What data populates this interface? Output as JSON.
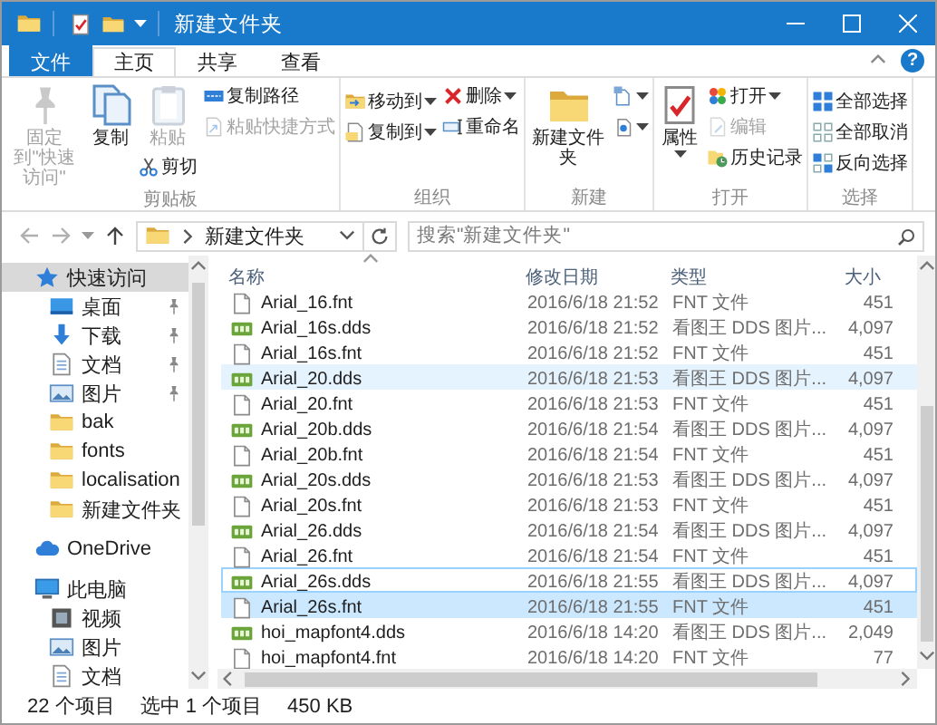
{
  "window": {
    "title": "新建文件夹"
  },
  "ribbon_tabs": [
    {
      "label": "文件",
      "kind": "file",
      "selected": false
    },
    {
      "label": "主页",
      "kind": "tab",
      "selected": true
    },
    {
      "label": "共享",
      "kind": "tab",
      "selected": false
    },
    {
      "label": "查看",
      "kind": "tab",
      "selected": false
    }
  ],
  "help_button": "?",
  "ribbon": {
    "groups": [
      {
        "label": "剪贴板",
        "columns": [
          [
            {
              "kind": "large",
              "label": "固定到\"快速访问\"",
              "disabled": true,
              "dropdown": false
            }
          ],
          [
            {
              "kind": "large",
              "label": "复制",
              "disabled": false,
              "dropdown": false
            }
          ],
          [
            {
              "kind": "large",
              "label": "粘贴",
              "disabled": true,
              "dropdown": false
            },
            {
              "kind": "small",
              "label": "剪切",
              "disabled": false,
              "dropdown": false
            }
          ],
          [
            {
              "kind": "small",
              "label": "复制路径",
              "disabled": false,
              "dropdown": false
            },
            {
              "kind": "small",
              "label": "粘贴快捷方式",
              "disabled": true,
              "dropdown": false
            }
          ]
        ]
      },
      {
        "label": "组织",
        "columns": [
          [
            {
              "kind": "small",
              "label": "移动到",
              "disabled": false,
              "dropdown": true
            },
            {
              "kind": "small",
              "label": "复制到",
              "disabled": false,
              "dropdown": true
            }
          ],
          [
            {
              "kind": "small",
              "label": "删除",
              "disabled": false,
              "dropdown": true
            },
            {
              "kind": "small",
              "label": "重命名",
              "disabled": false,
              "dropdown": false
            }
          ]
        ]
      },
      {
        "label": "新建",
        "columns": [
          [
            {
              "kind": "large",
              "label": "新建文件夹",
              "disabled": false,
              "dropdown": false
            }
          ],
          [
            {
              "kind": "icon",
              "disabled": false,
              "dropdown": true
            },
            {
              "kind": "icon",
              "disabled": false,
              "dropdown": true
            }
          ]
        ]
      },
      {
        "label": "打开",
        "columns": [
          [
            {
              "kind": "large",
              "label": "属性",
              "disabled": false,
              "dropdown": true
            }
          ],
          [
            {
              "kind": "small",
              "label": "打开",
              "disabled": false,
              "dropdown": true
            },
            {
              "kind": "small",
              "label": "编辑",
              "disabled": true,
              "dropdown": false
            },
            {
              "kind": "small",
              "label": "历史记录",
              "disabled": false,
              "dropdown": false
            }
          ]
        ]
      },
      {
        "label": "选择",
        "columns": [
          [
            {
              "kind": "small",
              "label": "全部选择",
              "disabled": false,
              "dropdown": false
            },
            {
              "kind": "small",
              "label": "全部取消",
              "disabled": false,
              "dropdown": false
            },
            {
              "kind": "small",
              "label": "反向选择",
              "disabled": false,
              "dropdown": false
            }
          ]
        ]
      }
    ]
  },
  "address": {
    "segments": [
      "新建文件夹"
    ]
  },
  "search": {
    "placeholder": "搜索\"新建文件夹\""
  },
  "nav": {
    "items": [
      {
        "label": "快速访问",
        "kind": "quick_access",
        "selected": true,
        "pinned": false,
        "children": [
          {
            "label": "桌面",
            "kind": "desktop",
            "selected": false,
            "pinned": true
          },
          {
            "label": "下载",
            "kind": "downloads",
            "selected": false,
            "pinned": true
          },
          {
            "label": "文档",
            "kind": "documents",
            "selected": false,
            "pinned": true
          },
          {
            "label": "图片",
            "kind": "pictures",
            "selected": false,
            "pinned": true
          },
          {
            "label": "bak",
            "kind": "folder",
            "selected": false,
            "pinned": false
          },
          {
            "label": "fonts",
            "kind": "folder",
            "selected": false,
            "pinned": false
          },
          {
            "label": "localisation",
            "kind": "folder",
            "selected": false,
            "pinned": false
          },
          {
            "label": "新建文件夹",
            "kind": "folder",
            "selected": false,
            "pinned": false
          }
        ]
      },
      {
        "label": "OneDrive",
        "kind": "cloud",
        "selected": false,
        "pinned": false
      },
      {
        "label": "此电脑",
        "kind": "computer",
        "selected": false,
        "pinned": false,
        "children": [
          {
            "label": "视频",
            "kind": "videos",
            "selected": false,
            "pinned": false
          },
          {
            "label": "图片",
            "kind": "pictures",
            "selected": false,
            "pinned": false
          },
          {
            "label": "文档",
            "kind": "documents",
            "selected": false,
            "pinned": false
          }
        ]
      }
    ]
  },
  "files": {
    "columns": [
      {
        "label": "名称",
        "sorted": true
      },
      {
        "label": "修改日期",
        "sorted": false
      },
      {
        "label": "类型",
        "sorted": false
      },
      {
        "label": "大小",
        "sorted": false
      }
    ],
    "rows": [
      {
        "name": "Arial_16.fnt",
        "kind": "fnt",
        "modified": "2016/6/18 21:52",
        "type": "FNT 文件",
        "size": "451",
        "selected": false,
        "hovered": false,
        "focused": false
      },
      {
        "name": "Arial_16s.dds",
        "kind": "dds",
        "modified": "2016/6/18 21:52",
        "type": "看图王 DDS 图片...",
        "size": "4,097",
        "selected": false,
        "hovered": false,
        "focused": false
      },
      {
        "name": "Arial_16s.fnt",
        "kind": "fnt",
        "modified": "2016/6/18 21:52",
        "type": "FNT 文件",
        "size": "451",
        "selected": false,
        "hovered": false,
        "focused": false
      },
      {
        "name": "Arial_20.dds",
        "kind": "dds",
        "modified": "2016/6/18 21:53",
        "type": "看图王 DDS 图片...",
        "size": "4,097",
        "selected": false,
        "hovered": true,
        "focused": false
      },
      {
        "name": "Arial_20.fnt",
        "kind": "fnt",
        "modified": "2016/6/18 21:53",
        "type": "FNT 文件",
        "size": "451",
        "selected": false,
        "hovered": false,
        "focused": false
      },
      {
        "name": "Arial_20b.dds",
        "kind": "dds",
        "modified": "2016/6/18 21:54",
        "type": "看图王 DDS 图片...",
        "size": "4,097",
        "selected": false,
        "hovered": false,
        "focused": false
      },
      {
        "name": "Arial_20b.fnt",
        "kind": "fnt",
        "modified": "2016/6/18 21:54",
        "type": "FNT 文件",
        "size": "451",
        "selected": false,
        "hovered": false,
        "focused": false
      },
      {
        "name": "Arial_20s.dds",
        "kind": "dds",
        "modified": "2016/6/18 21:53",
        "type": "看图王 DDS 图片...",
        "size": "4,097",
        "selected": false,
        "hovered": false,
        "focused": false
      },
      {
        "name": "Arial_20s.fnt",
        "kind": "fnt",
        "modified": "2016/6/18 21:53",
        "type": "FNT 文件",
        "size": "451",
        "selected": false,
        "hovered": false,
        "focused": false
      },
      {
        "name": "Arial_26.dds",
        "kind": "dds",
        "modified": "2016/6/18 21:54",
        "type": "看图王 DDS 图片...",
        "size": "4,097",
        "selected": false,
        "hovered": false,
        "focused": false
      },
      {
        "name": "Arial_26.fnt",
        "kind": "fnt",
        "modified": "2016/6/18 21:54",
        "type": "FNT 文件",
        "size": "451",
        "selected": false,
        "hovered": false,
        "focused": false
      },
      {
        "name": "Arial_26s.dds",
        "kind": "dds",
        "modified": "2016/6/18 21:55",
        "type": "看图王 DDS 图片...",
        "size": "4,097",
        "selected": false,
        "hovered": false,
        "focused": true
      },
      {
        "name": "Arial_26s.fnt",
        "kind": "fnt",
        "modified": "2016/6/18 21:55",
        "type": "FNT 文件",
        "size": "451",
        "selected": true,
        "hovered": false,
        "focused": false
      },
      {
        "name": "hoi_mapfont4.dds",
        "kind": "dds",
        "modified": "2016/6/18 14:20",
        "type": "看图王 DDS 图片...",
        "size": "2,049",
        "selected": false,
        "hovered": false,
        "focused": false
      },
      {
        "name": "hoi_mapfont4.fnt",
        "kind": "fnt",
        "modified": "2016/6/18 14:20",
        "type": "FNT 文件",
        "size": "77",
        "selected": false,
        "hovered": false,
        "focused": false
      }
    ]
  },
  "status_bar": {
    "item_count": "22 个项目",
    "selection": "选中 1 个项目",
    "size": "450 KB"
  }
}
